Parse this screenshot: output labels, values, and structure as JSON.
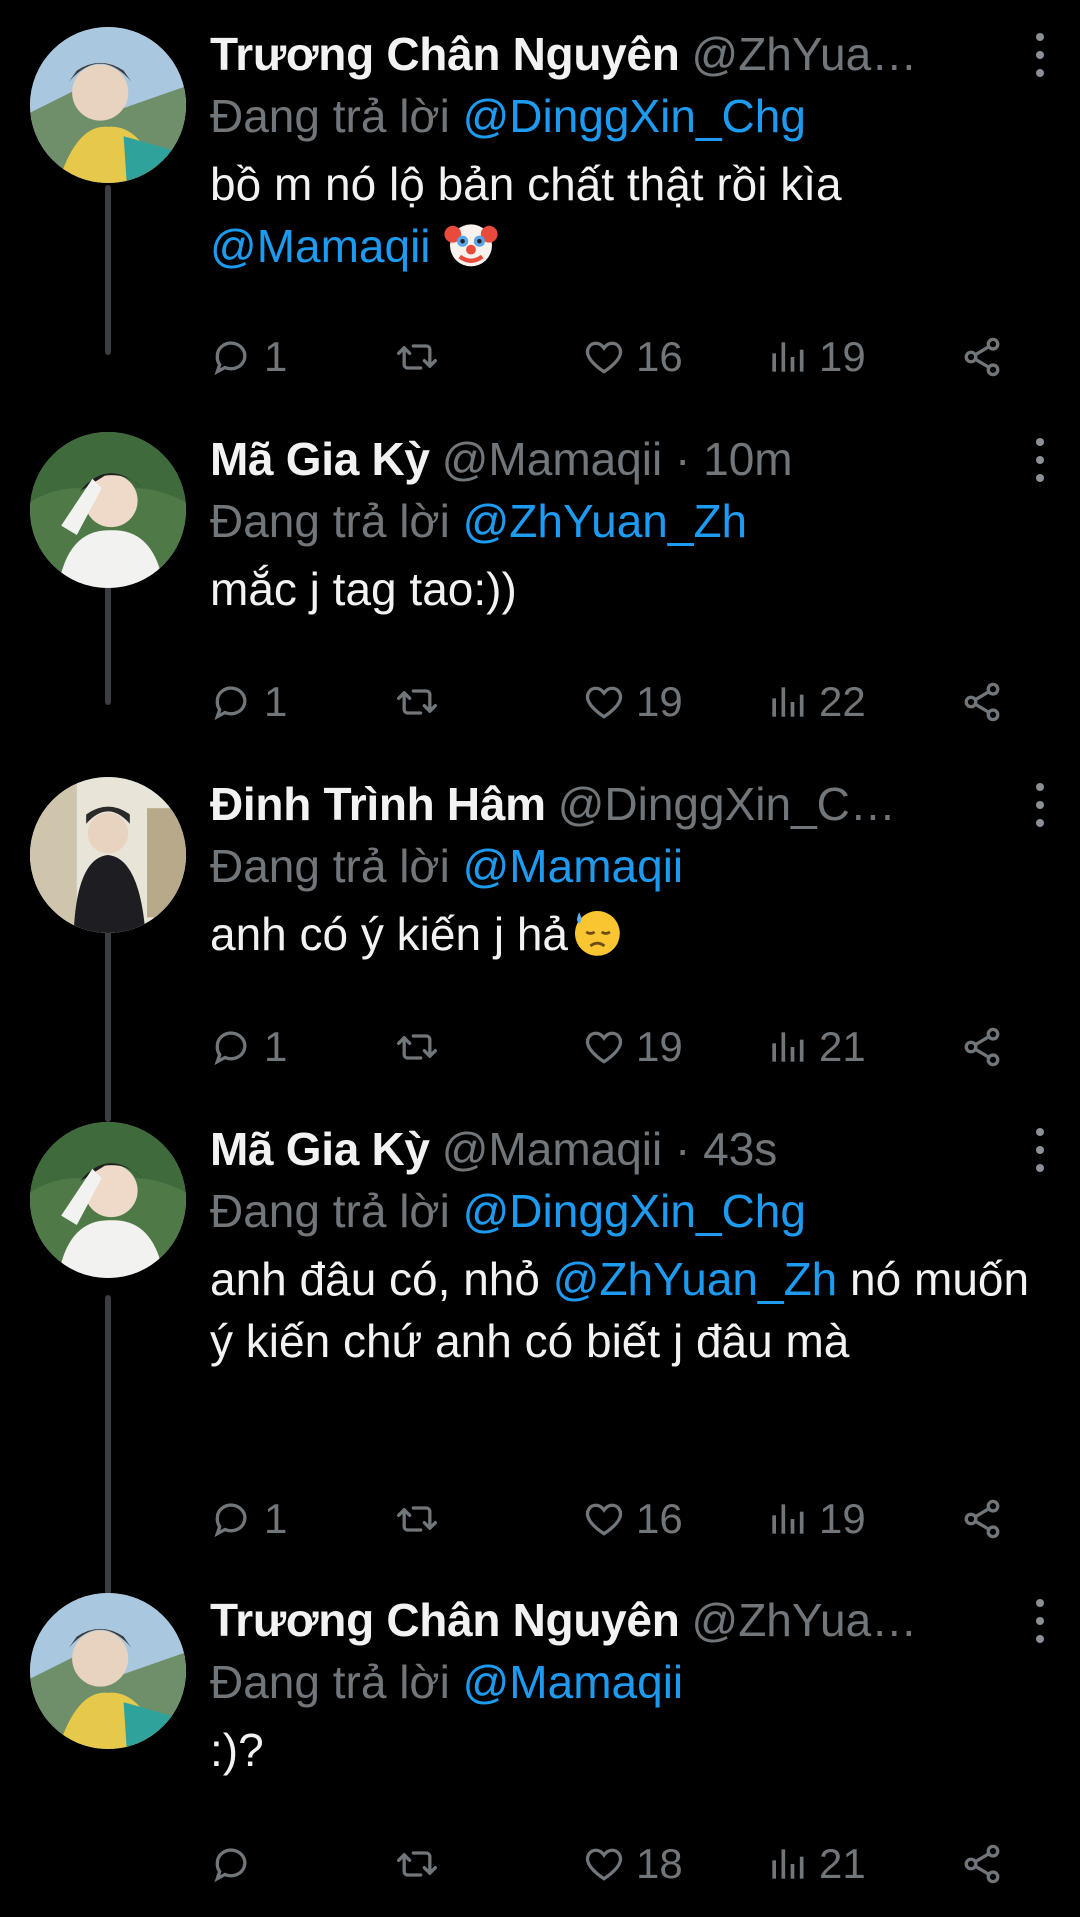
{
  "tweets": [
    {
      "name": "Trương Chân Nguyên",
      "handle": "@ZhYua…",
      "replying_prefix": "Đang trả lời ",
      "replying_to": "@DinggXin_Chg",
      "text_parts": [
        {
          "t": "bồ m nó lộ bản chất thật rồi kìa"
        },
        {
          "br": true
        },
        {
          "t": "@Mamaqii",
          "mention": true
        },
        {
          "t": " "
        },
        {
          "emoji": "clown"
        }
      ],
      "replies": "1",
      "retweets": "",
      "likes": "16",
      "views": "19"
    },
    {
      "name": "Mã Gia Kỳ",
      "handle": "@Mamaqii · 10m",
      "replying_prefix": "Đang trả lời ",
      "replying_to": "@ZhYuan_Zh",
      "text_parts": [
        {
          "t": "mắc j tag tao:))"
        }
      ],
      "replies": "1",
      "retweets": "",
      "likes": "19",
      "views": "22"
    },
    {
      "name": "Đinh Trình Hâm",
      "handle": "@DinggXin_C…",
      "replying_prefix": "Đang trả lời ",
      "replying_to": "@Mamaqii",
      "text_parts": [
        {
          "t": "anh có ý kiến j hả"
        },
        {
          "emoji": "sweat"
        }
      ],
      "replies": "1",
      "retweets": "",
      "likes": "19",
      "views": "21"
    },
    {
      "name": "Mã Gia Kỳ",
      "handle": "@Mamaqii · 43s",
      "replying_prefix": "Đang trả lời ",
      "replying_to": "@DinggXin_Chg",
      "text_parts": [
        {
          "t": "anh đâu có, nhỏ "
        },
        {
          "t": "@ZhYuan_Zh",
          "mention": true
        },
        {
          "t": " nó muốn ý kiến chứ anh có biết j đâu mà"
        }
      ],
      "replies": "1",
      "retweets": "",
      "likes": "16",
      "views": "19"
    },
    {
      "name": "Trương Chân Nguyên",
      "handle": "@ZhYua…",
      "replying_prefix": "Đang trả lời ",
      "replying_to": "@Mamaqii",
      "text_parts": [
        {
          "t": ":)?"
        }
      ],
      "replies": "",
      "retweets": "",
      "likes": "18",
      "views": "21"
    }
  ],
  "icons": {
    "reply": "reply-icon",
    "retweet": "retweet-icon",
    "like": "heart-icon",
    "views": "views-icon",
    "share": "share-icon",
    "more": "more-icon"
  },
  "colors": {
    "background": "#000000",
    "text": "#f2f2f2",
    "secondary": "#71767b",
    "mention": "#1d9bf0",
    "thread_line": "#3a3d41"
  }
}
